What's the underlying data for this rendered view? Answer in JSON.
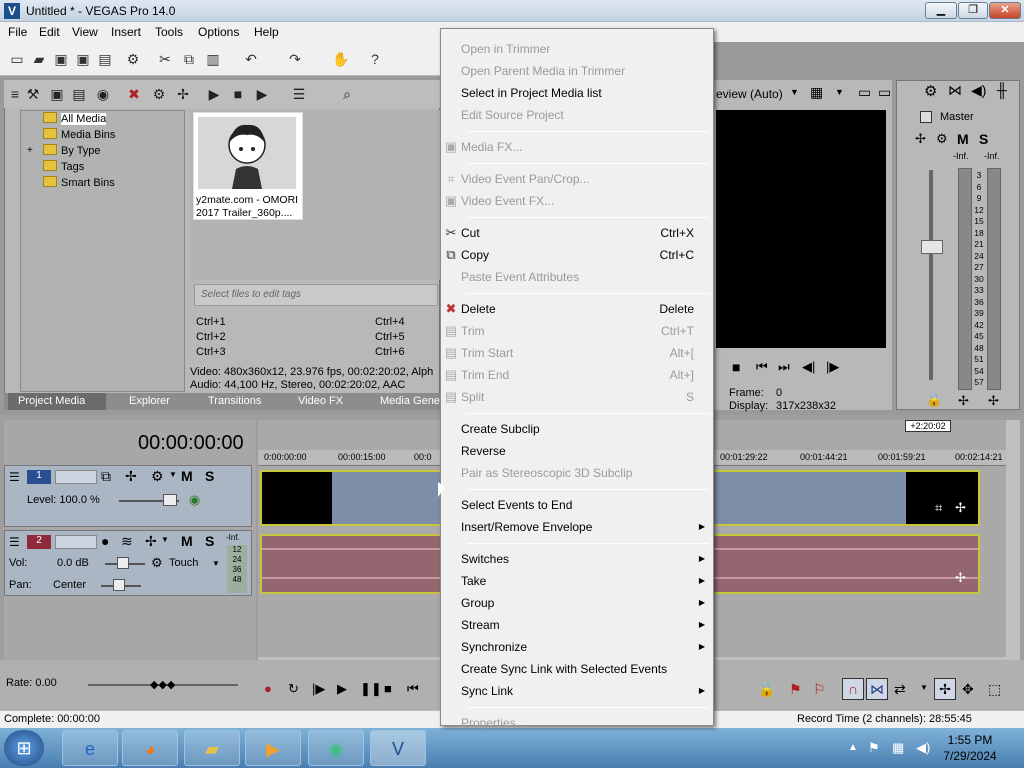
{
  "window": {
    "title": "Untitled * - VEGAS Pro 14.0"
  },
  "menu": [
    "File",
    "Edit",
    "View",
    "Insert",
    "Tools",
    "Options",
    "Help"
  ],
  "media": {
    "tree": [
      "All Media",
      "Media Bins",
      "By Type",
      "Tags",
      "Smart Bins"
    ],
    "thumb_caption_1": "y2mate.com - OMORI",
    "thumb_caption_2": "2017 Trailer_360p....",
    "tags_placeholder": "Select files to edit tags",
    "shortcuts": [
      "Ctrl+1",
      "Ctrl+4",
      "Ctrl+2",
      "Ctrl+5",
      "Ctrl+3",
      "Ctrl+6"
    ],
    "info_video": "Video: 480x360x12, 23.976 fps, 00:02:20:02, Alph",
    "info_audio": "Audio: 44,100 Hz, Stereo, 00:02:20:02, AAC",
    "tabs": [
      "Project Media",
      "Explorer",
      "Transitions",
      "Video FX",
      "Media Gene"
    ]
  },
  "preview": {
    "mode": "eview (Auto)",
    "frame_label": "Frame:",
    "frame_value": "0",
    "display_label": "Display:",
    "display_value": "317x238x32"
  },
  "mixer": {
    "title": "Master",
    "inf_left": "-Inf.",
    "inf_right": "-Inf.",
    "scale": [
      "3",
      "6",
      "9",
      "12",
      "15",
      "18",
      "21",
      "24",
      "27",
      "30",
      "33",
      "36",
      "39",
      "42",
      "45",
      "48",
      "51",
      "54",
      "57"
    ]
  },
  "timeline": {
    "timecode": "00:00:00:00",
    "end_marker": "+2:20:02",
    "ruler": [
      "0:00:00:00",
      "00:00:15:00",
      "00:0",
      "00:01:29:22",
      "00:01:44:21",
      "00:01:59:21",
      "00:02:14:21"
    ],
    "track1": {
      "num": "1",
      "level_label": "Level: 100.0 %"
    },
    "track2": {
      "num": "2",
      "vol_label": "Vol:",
      "vol_value": "0.0 dB",
      "pan_label": "Pan:",
      "pan_value": "Center",
      "mode": "Touch",
      "inf": "-Inf."
    },
    "rate": "Rate: 0.00"
  },
  "status": {
    "complete": "Complete: 00:00:00",
    "record_time": "Record Time (2 channels): 28:55:45"
  },
  "clock": {
    "time": "1:55 PM",
    "date": "7/29/2024"
  },
  "context_menu": {
    "items": [
      {
        "label": "Open in Trimmer",
        "disabled": true
      },
      {
        "label": "Open Parent Media in Trimmer",
        "disabled": true
      },
      {
        "label": "Select in Project Media list",
        "disabled": false
      },
      {
        "label": "Edit Source Project",
        "disabled": true
      },
      {
        "label": "Media FX...",
        "disabled": true
      },
      {
        "label": "Video Event Pan/Crop...",
        "disabled": true
      },
      {
        "label": "Video Event FX...",
        "disabled": true
      },
      {
        "label": "Cut",
        "shortcut": "Ctrl+X",
        "disabled": false
      },
      {
        "label": "Copy",
        "shortcut": "Ctrl+C",
        "disabled": false
      },
      {
        "label": "Paste Event Attributes",
        "disabled": true
      },
      {
        "label": "Delete",
        "shortcut": "Delete",
        "disabled": false
      },
      {
        "label": "Trim",
        "shortcut": "Ctrl+T",
        "disabled": true
      },
      {
        "label": "Trim Start",
        "shortcut": "Alt+[",
        "disabled": true
      },
      {
        "label": "Trim End",
        "shortcut": "Alt+]",
        "disabled": true
      },
      {
        "label": "Split",
        "shortcut": "S",
        "disabled": true
      },
      {
        "label": "Create Subclip",
        "disabled": false
      },
      {
        "label": "Reverse",
        "disabled": false
      },
      {
        "label": "Pair as Stereoscopic 3D Subclip",
        "disabled": true
      },
      {
        "label": "Select Events to End",
        "disabled": false
      },
      {
        "label": "Insert/Remove Envelope",
        "disabled": false,
        "submenu": true
      },
      {
        "label": "Switches",
        "disabled": false,
        "submenu": true
      },
      {
        "label": "Take",
        "disabled": false,
        "submenu": true
      },
      {
        "label": "Group",
        "disabled": false,
        "submenu": true
      },
      {
        "label": "Stream",
        "disabled": false,
        "submenu": true
      },
      {
        "label": "Synchronize",
        "disabled": false,
        "submenu": true
      },
      {
        "label": "Create Sync Link with Selected Events",
        "disabled": false
      },
      {
        "label": "Sync Link",
        "disabled": false,
        "submenu": true
      },
      {
        "label": "Properties...",
        "disabled": true
      }
    ]
  }
}
